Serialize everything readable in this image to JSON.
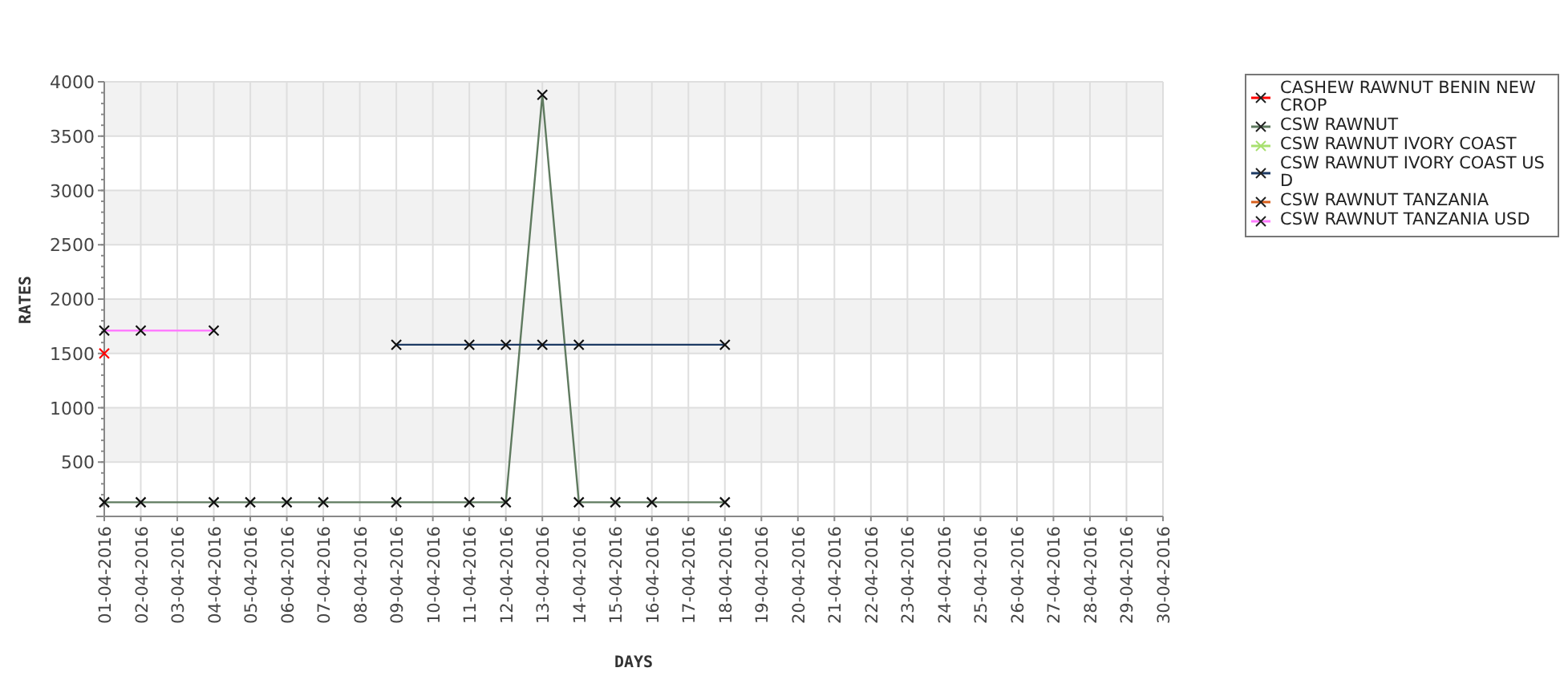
{
  "chart": {
    "chart_data": {
      "type": "line",
      "grid": true,
      "xlabel": "DAYS",
      "ylabel": "RATES",
      "categories": [
        "01-04-2016",
        "02-04-2016",
        "03-04-2016",
        "04-04-2016",
        "05-04-2016",
        "06-04-2016",
        "07-04-2016",
        "08-04-2016",
        "09-04-2016",
        "10-04-2016",
        "11-04-2016",
        "12-04-2016",
        "13-04-2016",
        "14-04-2016",
        "15-04-2016",
        "16-04-2016",
        "17-04-2016",
        "18-04-2016",
        "19-04-2016",
        "20-04-2016",
        "21-04-2016",
        "22-04-2016",
        "23-04-2016",
        "24-04-2016",
        "25-04-2016",
        "26-04-2016",
        "27-04-2016",
        "28-04-2016",
        "29-04-2016",
        "30-04-2016"
      ],
      "ylim": [
        0,
        4000
      ],
      "yticks": [
        500,
        1000,
        1500,
        2000,
        2500,
        3000,
        3500,
        4000
      ],
      "series": [
        {
          "name": "CASHEW RAWNUT BENIN NEW CROP",
          "color": "#ff0000",
          "marker": "cross",
          "values": [
            1500,
            null,
            null,
            null,
            null,
            null,
            null,
            null,
            null,
            null,
            null,
            null,
            null,
            null,
            null,
            null,
            null,
            null,
            null,
            null,
            null,
            null,
            null,
            null,
            null,
            null,
            null,
            null,
            null,
            null
          ]
        },
        {
          "name": "CSW RAWNUT",
          "color": "#5f7a5f",
          "marker": "cross",
          "values": [
            130,
            130,
            null,
            130,
            130,
            130,
            130,
            null,
            130,
            null,
            130,
            130,
            3880,
            130,
            130,
            130,
            null,
            130,
            null,
            null,
            null,
            null,
            null,
            null,
            null,
            null,
            null,
            null,
            null,
            null
          ]
        },
        {
          "name": "CSW RAWNUT IVORY COAST",
          "color": "#a8e070",
          "values": [
            null,
            null,
            null,
            null,
            null,
            null,
            null,
            null,
            null,
            null,
            null,
            null,
            null,
            null,
            null,
            null,
            null,
            null,
            null,
            null,
            null,
            null,
            null,
            null,
            null,
            null,
            null,
            null,
            null,
            null
          ]
        },
        {
          "name": "CSW RAWNUT IVORY COAST USD",
          "color": "#1c3a64",
          "marker": "cross",
          "values": [
            null,
            null,
            null,
            null,
            null,
            null,
            null,
            null,
            1580,
            null,
            1580,
            1580,
            1580,
            1580,
            null,
            null,
            null,
            1580,
            null,
            null,
            null,
            null,
            null,
            null,
            null,
            null,
            null,
            null,
            null,
            null
          ]
        },
        {
          "name": "CSW RAWNUT TANZANIA",
          "color": "#d8601c",
          "values": [
            null,
            null,
            null,
            null,
            null,
            null,
            null,
            null,
            null,
            null,
            null,
            null,
            null,
            null,
            null,
            null,
            null,
            null,
            null,
            null,
            null,
            null,
            null,
            null,
            null,
            null,
            null,
            null,
            null,
            null
          ]
        },
        {
          "name": "CSW RAWNUT TANZANIA USD",
          "color": "#ff7cff",
          "marker": "cross",
          "values": [
            1710,
            1710,
            null,
            1710,
            null,
            null,
            null,
            null,
            null,
            null,
            null,
            null,
            null,
            null,
            null,
            null,
            null,
            null,
            null,
            null,
            null,
            null,
            null,
            null,
            null,
            null,
            null,
            null,
            null,
            null
          ]
        }
      ]
    }
  }
}
